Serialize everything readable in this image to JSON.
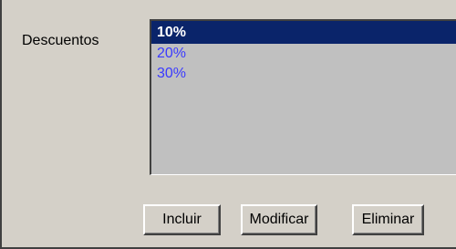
{
  "labels": {
    "discounts": "Descuentos"
  },
  "discount_list": {
    "items": [
      "10%",
      "20%",
      "30%"
    ],
    "selected": "10%"
  },
  "buttons": {
    "include": "Incluir",
    "modify": "Modificar",
    "delete": "Eliminar"
  },
  "colors": {
    "panel_background": "#d4d0c8",
    "list_background": "#c0c0c0",
    "selection_background": "#0a246a",
    "item_text": "#3a3aff"
  }
}
